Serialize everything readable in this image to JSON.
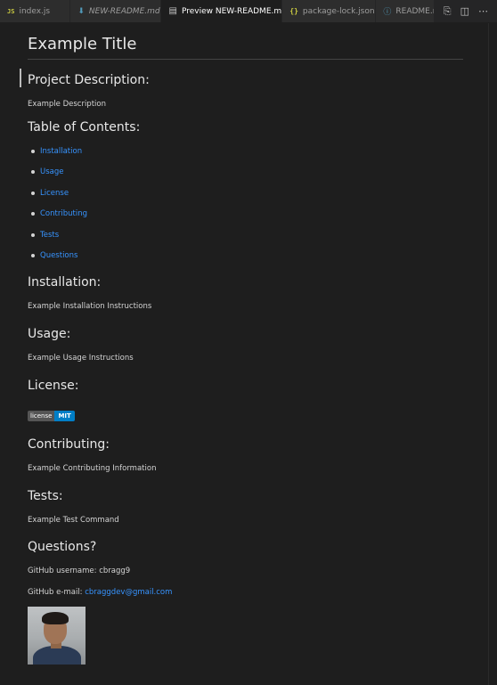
{
  "tabs": [
    {
      "icon": "JS",
      "label": "index.js",
      "italic": false
    },
    {
      "icon": "markdown-icon",
      "label": "NEW-README.md",
      "italic": true
    },
    {
      "icon": "preview-icon",
      "label": "Preview NEW-README.md",
      "italic": false,
      "active": true,
      "close": "✕"
    },
    {
      "icon": "{}",
      "label": "package-lock.json",
      "italic": false
    },
    {
      "icon": "info-icon",
      "label": "README.m",
      "italic": false
    }
  ],
  "doc": {
    "title": "Example Title",
    "description_heading": "Project Description:",
    "description": "Example Description",
    "toc_heading": "Table of Contents:",
    "toc": [
      "Installation",
      "Usage",
      "License",
      "Contributing",
      "Tests",
      "Questions"
    ],
    "installation_heading": "Installation:",
    "installation": "Example Installation Instructions",
    "usage_heading": "Usage:",
    "usage": "Example Usage Instructions",
    "license_heading": "License:",
    "badge_left": "license",
    "badge_right": "MIT",
    "contributing_heading": "Contributing:",
    "contributing": "Example Contributing Information",
    "tests_heading": "Tests:",
    "tests": "Example Test Command",
    "questions_heading": "Questions?",
    "github_username": "GitHub username: cbragg9",
    "github_email_label": "GitHub e-mail: ",
    "github_email": "cbraggdev@gmail.com"
  },
  "colors": {
    "accent_link": "#3794ff",
    "badge_blue": "#007ec6",
    "background": "#1e1e1e"
  }
}
